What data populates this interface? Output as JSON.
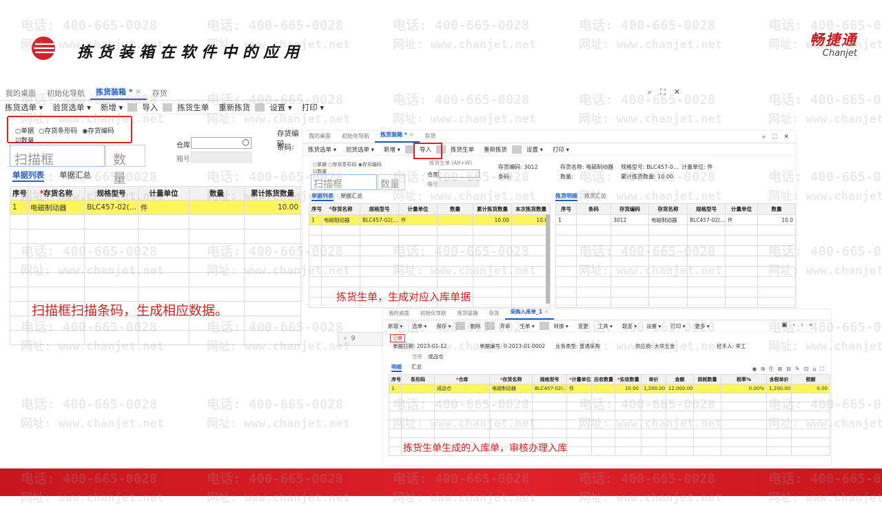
{
  "slide": {
    "title": "拣货装箱在软件中的应用",
    "brand_cn": "畅捷通",
    "brand_en": "Chanjet"
  },
  "watermark": {
    "phone": "电话: 400-665-0028",
    "url": "网址: www.chanjet.net"
  },
  "colors": {
    "accent": "#1e5bd6",
    "highlight": "#fdf65a",
    "note": "#d22",
    "brand": "#c8161d"
  },
  "win1": {
    "tabs": [
      {
        "label": "我的桌面"
      },
      {
        "label": "初始化导航"
      },
      {
        "label": "拣货装箱 *",
        "active": true
      },
      {
        "label": "存货"
      }
    ],
    "toolbar": [
      "拣货选单",
      "验货选单",
      "新增",
      "导入",
      "拣货生单",
      "重新拣货",
      "设置",
      "打印"
    ],
    "radio": {
      "opt1": "单据",
      "opt2": "存货条形码",
      "opt3": "存货编码",
      "check": "数量"
    },
    "scan_placeholder": "扫描框",
    "qty_placeholder": "数量",
    "warehouse_label": "仓库",
    "box_label": "箱号",
    "item_code_label": "存货编码",
    "barcode_label": "条码:",
    "subtabs": [
      "单据列表",
      "单据汇总"
    ],
    "columns": [
      "序号",
      "*存货名称",
      "规格型号",
      "计量单位",
      "数量",
      "累计拣货数量"
    ],
    "rows": [
      [
        "1",
        "电磁制动器",
        "BLC457-02(…",
        "件",
        "",
        "10.00"
      ]
    ],
    "page": "9",
    "note": "扫描框扫描条码，生成相应数据。"
  },
  "win2": {
    "tabs": [
      {
        "label": "我的桌面"
      },
      {
        "label": "初始化导航"
      },
      {
        "label": "拣货装箱 *",
        "active": true
      },
      {
        "label": "存货"
      }
    ],
    "toolbar": [
      "拣货选单",
      "验货选单",
      "新增",
      "导入",
      "拣货生单",
      "重新拣货",
      "设置",
      "打印"
    ],
    "tooltip": "拣货生单 (Alt+W)",
    "radio": {
      "opt1": "单据",
      "opt2": "存货条形码",
      "opt3": "存货编码",
      "check": "数量"
    },
    "scan_placeholder": "扫描框",
    "qty_placeholder": "数量",
    "warehouse_label": "仓库",
    "box_label": "箱号",
    "info": {
      "code": "存货编码: 3012",
      "name": "存货名称: 电磁制动器",
      "spec": "规格型号: BLC457-0...",
      "unit": "计量单位: 件",
      "barcode": "条码:",
      "qty": "数量:",
      "cum": "累计拣货数量: 10.00"
    },
    "subtabs": [
      "单据列表",
      "单据汇总"
    ],
    "columns": [
      "序号",
      "*存货名称",
      "规格型号",
      "计量单位",
      "数量",
      "累计拣货数量",
      "本次拣货数量"
    ],
    "rows": [
      [
        "1",
        "电磁制动器",
        "BLC457-02(…",
        "件",
        "",
        "10.00",
        "10.0"
      ]
    ],
    "right_tabs": [
      "拣货明细",
      "拣货汇总"
    ],
    "right_columns": [
      "序号",
      "条码",
      "存货编码",
      "存货名称",
      "规格型号",
      "计量单位",
      "数量"
    ],
    "right_rows": [
      [
        "1",
        "",
        "3012",
        "电磁制动器",
        "BLC457-02(…",
        "件",
        "10.0"
      ]
    ],
    "note": "拣货生单，生成对应入库单据"
  },
  "win3": {
    "tabs": [
      {
        "label": "我的桌面"
      },
      {
        "label": "初始化导航"
      },
      {
        "label": "拣货装箱"
      },
      {
        "label": "存货"
      },
      {
        "label": "采购入库单_1",
        "active": true
      }
    ],
    "toolbar": [
      "新增",
      "选单",
      "保存",
      "删除",
      "弃审",
      "生单",
      "转换",
      "变更",
      "工具",
      "联查",
      "设置",
      "打印",
      "更多"
    ],
    "status": "已审",
    "fields": {
      "date": "单据日期: 2023-01-12",
      "number": "单据编号: II-2023-01-0002",
      "biz": "业务类型: 普通采购",
      "vendor": "供应商: 大华五金",
      "handler": "经手人: 李工",
      "wh_label": "仓库",
      "wh": "成品仓"
    },
    "subtabs": [
      "明细",
      "汇总"
    ],
    "columns": [
      "序号",
      "条形码",
      "*仓库",
      "*存货名称",
      "规格型号",
      "*计量单位",
      "应收数量",
      "*实收数量",
      "单价",
      "金额",
      "损耗数量",
      "税率%",
      "含税单价",
      "税额"
    ],
    "rows": [
      [
        "1",
        "",
        "成品仓",
        "电磁制动器",
        "BLC457-02(…",
        "件",
        "",
        "10.00",
        "1,200.00",
        "12,000.00",
        "",
        "0.00%",
        "1,200.00",
        "0.00"
      ]
    ],
    "note": "拣货生单生成的入库单，审核办理入库"
  }
}
